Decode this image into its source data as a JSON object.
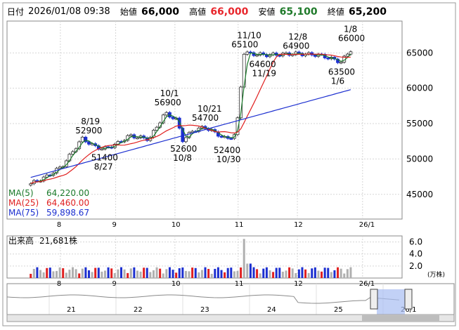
{
  "header": {
    "date_label": "日付",
    "datetime": "2026/01/08 09:38",
    "open_label": "始値",
    "open": "66,000",
    "high_label": "高値",
    "high": "66,000",
    "low_label": "安値",
    "low": "65,100",
    "close_label": "終値",
    "close": "65,200"
  },
  "chart_data": {
    "type": "candlestick",
    "y_ticks": [
      "45000",
      "50000",
      "55000",
      "60000",
      "65000"
    ],
    "ylim": [
      41500,
      69500
    ],
    "x_ticks": [
      "8",
      "9",
      "10",
      "11",
      "12",
      "26/1"
    ],
    "x_ticks_pos": [
      0.135,
      0.275,
      0.425,
      0.585,
      0.735,
      0.9
    ],
    "candles_hint": "approximate daily candles",
    "ma": [
      {
        "name": "MA(5)",
        "value": "64,220.00",
        "color": "#1a7a2a"
      },
      {
        "name": "MA(25)",
        "value": "64,460.00",
        "color": "#e02020"
      },
      {
        "name": "MA(75)",
        "value": "59,898.67",
        "color": "#1c2fd0"
      }
    ],
    "annotations": [
      {
        "text": [
          "8/19",
          "52900"
        ],
        "x": 0.205,
        "y": 52900,
        "pos": "above"
      },
      {
        "text": [
          "51400",
          "8/27"
        ],
        "x": 0.245,
        "y": 51400,
        "pos": "below"
      },
      {
        "text": [
          "10/1",
          "56900"
        ],
        "x": 0.405,
        "y": 56900,
        "pos": "above"
      },
      {
        "text": [
          "10/21",
          "54700"
        ],
        "x": 0.5,
        "y": 54700,
        "pos": "above"
      },
      {
        "text": [
          "52600",
          "10/8"
        ],
        "x": 0.445,
        "y": 52600,
        "pos": "below"
      },
      {
        "text": [
          "52400",
          "10/30"
        ],
        "x": 0.555,
        "y": 52400,
        "pos": "below"
      },
      {
        "text": [
          "11/10",
          "65100"
        ],
        "x": 0.6,
        "y": 65100,
        "pos": "above"
      },
      {
        "text": [
          "64600",
          "11/19"
        ],
        "x": 0.645,
        "y": 64600,
        "pos": "below"
      },
      {
        "text": [
          "12/8",
          "64900"
        ],
        "x": 0.73,
        "y": 64900,
        "pos": "above"
      },
      {
        "text": [
          "1/8",
          "66000"
        ],
        "x": 0.87,
        "y": 66000,
        "pos": "above"
      },
      {
        "text": [
          "63500",
          "1/6"
        ],
        "x": 0.845,
        "y": 63500,
        "pos": "below"
      }
    ],
    "volume": {
      "label": "出来高",
      "value": "21,681株",
      "y_ticks": [
        "2.0",
        "4.0",
        "6.0"
      ],
      "unit": "(万株)",
      "ylim": [
        0,
        7
      ]
    },
    "navigator": {
      "x_ticks": [
        "21",
        "22",
        "23",
        "24",
        "25",
        "26/1"
      ]
    }
  }
}
